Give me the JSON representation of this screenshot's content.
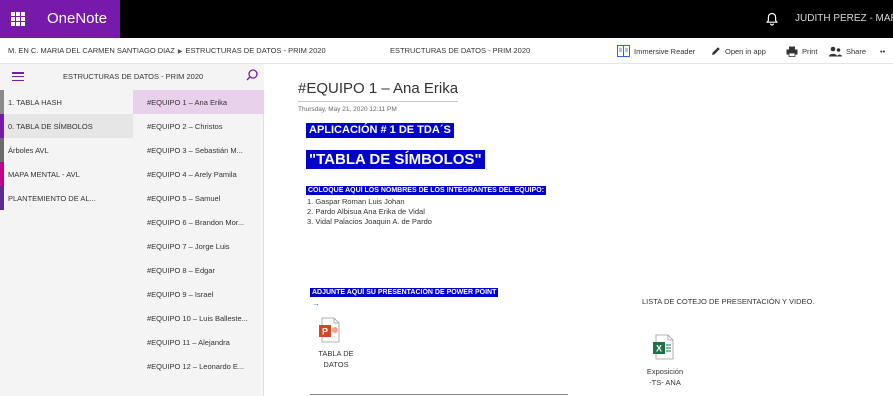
{
  "app": {
    "name": "OneNote",
    "brand_color": "#7719aa",
    "user_name": "JUDITH PEREZ - MARCIA"
  },
  "header": {
    "breadcrumb": [
      "M. EN C. MARIA DEL CARMEN SANTIAGO DIAZ",
      "ESTRUCTURAS DE DATOS - PRIM 2020"
    ],
    "breadcrumb_separator": "▶",
    "notebook_title": "ESTRUCTURAS DE DATOS - PRIM 2020",
    "tools": [
      {
        "label": "Immersive Reader",
        "icon": "immersive-reader-icon"
      },
      {
        "label": "Open in app",
        "icon": "pencil-icon"
      },
      {
        "label": "Print",
        "icon": "printer-icon"
      },
      {
        "label": "Share",
        "icon": "share-people-icon"
      },
      {
        "label": "••",
        "icon": "more-icon"
      }
    ]
  },
  "navigation": {
    "notebook_name": "ESTRUCTURAS DE DATOS - PRIM 2020",
    "sections": [
      {
        "label": "1. TABLA HASH",
        "color": "#8a8a8a",
        "selected": false
      },
      {
        "label": "0. TABLA DE SÍMBOLOS",
        "color": "#7719aa",
        "selected": true
      },
      {
        "label": "Árboles AVL",
        "color": "#6b6b6b",
        "selected": false
      },
      {
        "label": "MAPA MENTAL - AVL",
        "color": "#c4008a",
        "selected": false
      },
      {
        "label": "PLANTEMIENTO DE AL...",
        "color": "#5c2d91",
        "selected": false
      }
    ],
    "pages": [
      {
        "label": "#EQUIPO 1 – Ana Erika",
        "selected": true
      },
      {
        "label": "#EQUIPO 2 – Christos",
        "selected": false
      },
      {
        "label": "#EQUIPO 3 – Sebastián M...",
        "selected": false
      },
      {
        "label": "#EQUIPO 4 – Arely Pamila",
        "selected": false
      },
      {
        "label": "#EQUIPO 5 – Samuel",
        "selected": false
      },
      {
        "label": "#EQUIPO 6 – Brandon Mor...",
        "selected": false
      },
      {
        "label": "#EQUIPO 7 – Jorge Luis",
        "selected": false
      },
      {
        "label": "#EQUIPO 8 – Edgar",
        "selected": false
      },
      {
        "label": "#EQUIPO 9 – Israel",
        "selected": false
      },
      {
        "label": "#EQUIPO 10 – Luis Balleste...",
        "selected": false
      },
      {
        "label": "#EQUIPO 11 – Alejandra",
        "selected": false
      },
      {
        "label": "#EQUIPO 12 – Leonardo E...",
        "selected": false
      }
    ]
  },
  "page": {
    "title": "#EQUIPO 1 – Ana Erika",
    "date": "Thursday, May 21, 2020   12:11 PM",
    "heading1": "APLICACIÓN # 1 DE TDA´S",
    "heading2": "\"TABLA DE SÍMBOLOS\"",
    "members_prompt": "COLOQUE AQUÍ LOS NOMBRES DE LOS INTEGRANTES DEL EQUIPO:",
    "members": [
      "1. Gaspar Roman Luis Johan",
      "2. Pardo Albisua Ana Erika de Vidal",
      "3. Vidal Palacios Joaquin A. de Pardo"
    ],
    "attach_prompt": "ADJUNTE AQUÍ SU PRESENTACIÓN DE POWER POINT",
    "arrow": "→",
    "ppt_attachment": {
      "line1": "TABLA DE",
      "line2": "DATOS",
      "icon": "powerpoint-file-icon"
    },
    "checklist_text": "LISTA DE COTEJO DE PRESENTACIÓN Y VIDEO.",
    "xls_attachment": {
      "line1": "Exposición",
      "line2": "-TS- ANA",
      "icon": "excel-file-icon"
    },
    "highlight_color": "#0000cc"
  }
}
